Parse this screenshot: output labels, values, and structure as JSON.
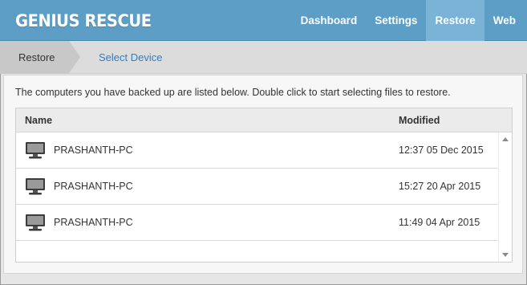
{
  "header": {
    "logo": "GENIUS RESCUE",
    "nav": [
      {
        "label": "Dashboard",
        "active": false
      },
      {
        "label": "Settings",
        "active": false
      },
      {
        "label": "Restore",
        "active": true
      },
      {
        "label": "Web",
        "active": false
      }
    ]
  },
  "breadcrumb": {
    "current": "Restore",
    "next": "Select Device"
  },
  "content": {
    "intro": "The computers you have backed up are listed below. Double click to start selecting files to restore.",
    "columns": {
      "name": "Name",
      "modified": "Modified"
    },
    "rows": [
      {
        "name": "PRASHANTH-PC",
        "modified": "12:37 05 Dec 2015",
        "icon": "computer-icon"
      },
      {
        "name": "PRASHANTH-PC",
        "modified": "15:27 20 Apr 2015",
        "icon": "computer-icon"
      },
      {
        "name": "PRASHANTH-PC",
        "modified": "11:49 04 Apr 2015",
        "icon": "computer-icon"
      }
    ]
  },
  "colors": {
    "header_bg": "#5c9ec6",
    "nav_active_bg": "#7ab3d6",
    "link": "#2f7fc4"
  }
}
